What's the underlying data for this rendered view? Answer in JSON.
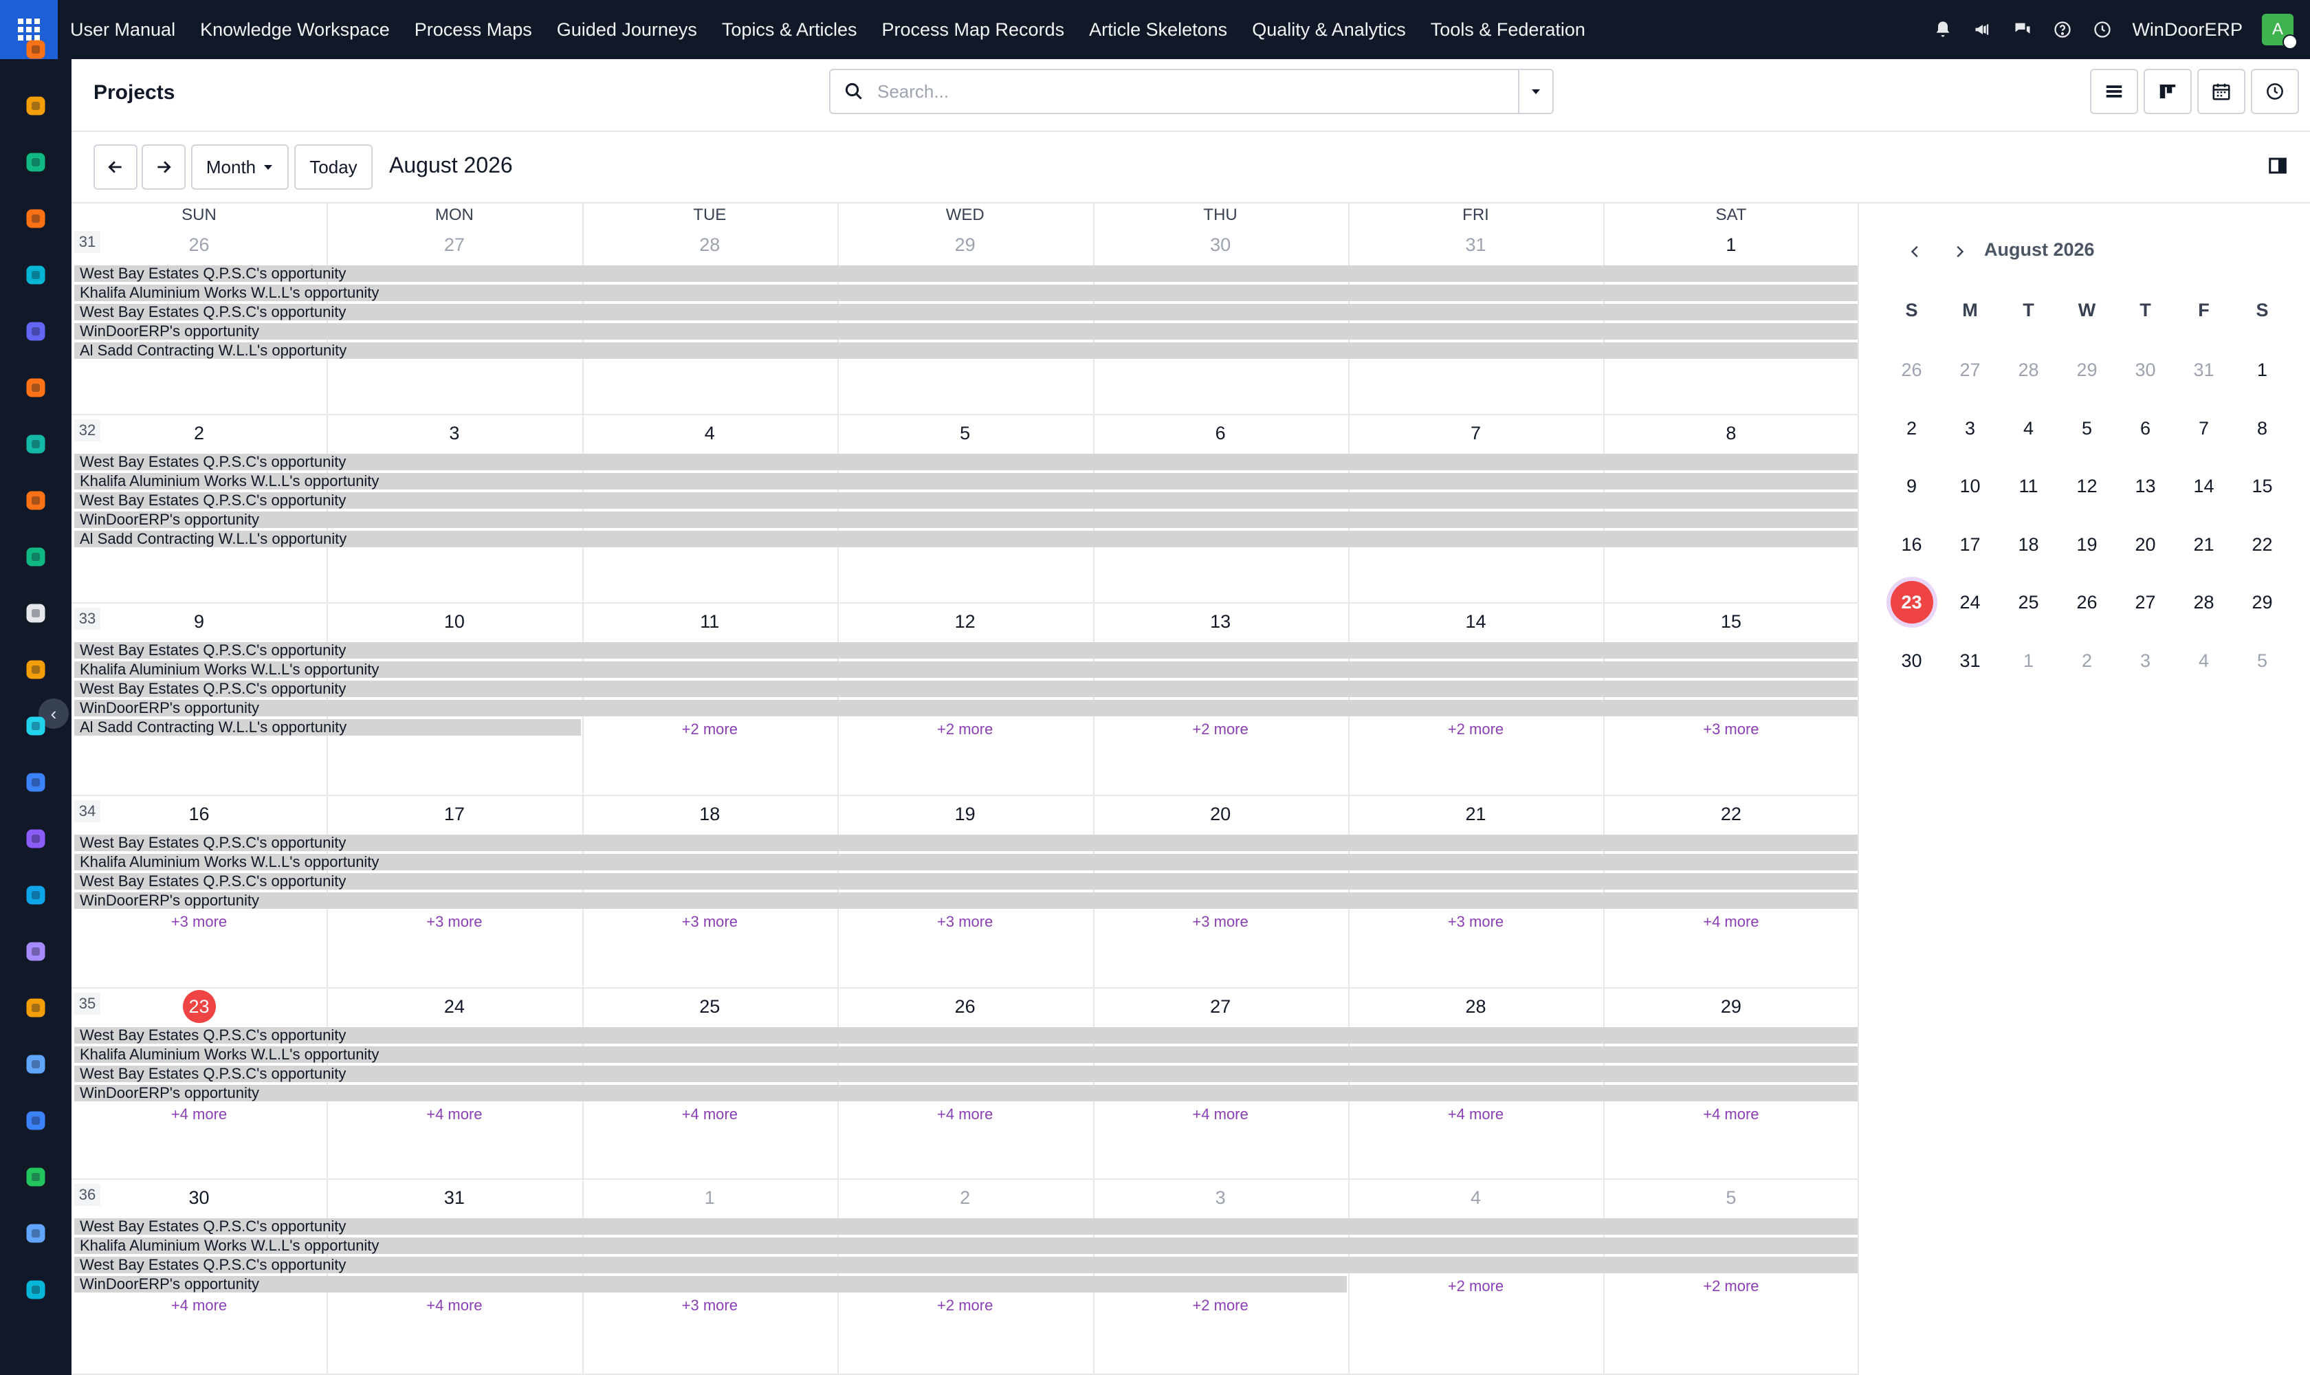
{
  "topbar": {
    "menu": [
      "User Manual",
      "Knowledge Workspace",
      "Process Maps",
      "Guided Journeys",
      "Topics & Articles",
      "Process Map Records",
      "Article Skeletons",
      "Quality & Analytics",
      "Tools & Federation"
    ],
    "company": "WinDoorERP",
    "avatar_letter": "A",
    "icons": [
      "bell-icon",
      "megaphone-icon",
      "chat-icon",
      "help-icon",
      "clock-icon"
    ]
  },
  "header": {
    "title": "Projects",
    "search_placeholder": "Search..."
  },
  "toolbar": {
    "prev_label": "←",
    "next_label": "→",
    "scale_label": "Month",
    "today_label": "Today",
    "period_label": "August 2026"
  },
  "calendar": {
    "weekdays": [
      "SUN",
      "MON",
      "TUE",
      "WED",
      "THU",
      "FRI",
      "SAT"
    ],
    "weeks": [
      {
        "number": "31",
        "days": [
          {
            "d": "26",
            "muted": true
          },
          {
            "d": "27",
            "muted": true
          },
          {
            "d": "28",
            "muted": true
          },
          {
            "d": "29",
            "muted": true
          },
          {
            "d": "30",
            "muted": true
          },
          {
            "d": "31",
            "muted": true
          },
          {
            "d": "1"
          }
        ],
        "events": [
          {
            "title": "West Bay Estates Q.P.S.C's opportunity",
            "start": 0,
            "span": 7
          },
          {
            "title": "Khalifa Aluminium Works W.L.L's opportunity",
            "start": 0,
            "span": 7
          },
          {
            "title": "West Bay Estates Q.P.S.C's opportunity",
            "start": 0,
            "span": 7
          },
          {
            "title": "WinDoorERP's opportunity",
            "start": 0,
            "span": 7
          },
          {
            "title": "Al Sadd Contracting W.L.L's opportunity",
            "start": 0,
            "span": 7
          }
        ],
        "more": []
      },
      {
        "number": "32",
        "days": [
          {
            "d": "2"
          },
          {
            "d": "3"
          },
          {
            "d": "4"
          },
          {
            "d": "5"
          },
          {
            "d": "6"
          },
          {
            "d": "7"
          },
          {
            "d": "8"
          }
        ],
        "events": [
          {
            "title": "West Bay Estates Q.P.S.C's opportunity",
            "start": 0,
            "span": 7
          },
          {
            "title": "Khalifa Aluminium Works W.L.L's opportunity",
            "start": 0,
            "span": 7
          },
          {
            "title": "West Bay Estates Q.P.S.C's opportunity",
            "start": 0,
            "span": 7
          },
          {
            "title": "WinDoorERP's opportunity",
            "start": 0,
            "span": 7
          },
          {
            "title": "Al Sadd Contracting W.L.L's opportunity",
            "start": 0,
            "span": 7
          }
        ],
        "more": []
      },
      {
        "number": "33",
        "days": [
          {
            "d": "9"
          },
          {
            "d": "10"
          },
          {
            "d": "11"
          },
          {
            "d": "12"
          },
          {
            "d": "13"
          },
          {
            "d": "14"
          },
          {
            "d": "15"
          }
        ],
        "events": [
          {
            "title": "West Bay Estates Q.P.S.C's opportunity",
            "start": 0,
            "span": 7
          },
          {
            "title": "Khalifa Aluminium Works W.L.L's opportunity",
            "start": 0,
            "span": 7
          },
          {
            "title": "West Bay Estates Q.P.S.C's opportunity",
            "start": 0,
            "span": 7
          },
          {
            "title": "WinDoorERP's opportunity",
            "start": 0,
            "span": 7
          },
          {
            "title": "Al Sadd Contracting W.L.L's opportunity",
            "start": 0,
            "span": 2
          }
        ],
        "more": [
          {
            "col": 2,
            "label": "+2 more",
            "row": 4
          },
          {
            "col": 3,
            "label": "+2 more",
            "row": 4
          },
          {
            "col": 4,
            "label": "+2 more",
            "row": 4
          },
          {
            "col": 5,
            "label": "+2 more",
            "row": 4
          },
          {
            "col": 6,
            "label": "+3 more",
            "row": 4
          }
        ]
      },
      {
        "number": "34",
        "days": [
          {
            "d": "16"
          },
          {
            "d": "17"
          },
          {
            "d": "18"
          },
          {
            "d": "19"
          },
          {
            "d": "20"
          },
          {
            "d": "21"
          },
          {
            "d": "22"
          }
        ],
        "events": [
          {
            "title": "West Bay Estates Q.P.S.C's opportunity",
            "start": 0,
            "span": 7
          },
          {
            "title": "Khalifa Aluminium Works W.L.L's opportunity",
            "start": 0,
            "span": 7
          },
          {
            "title": "West Bay Estates Q.P.S.C's opportunity",
            "start": 0,
            "span": 7
          },
          {
            "title": "WinDoorERP's opportunity",
            "start": 0,
            "span": 7
          }
        ],
        "more": [
          {
            "col": 0,
            "label": "+3 more",
            "row": 4
          },
          {
            "col": 1,
            "label": "+3 more",
            "row": 4
          },
          {
            "col": 2,
            "label": "+3 more",
            "row": 4
          },
          {
            "col": 3,
            "label": "+3 more",
            "row": 4
          },
          {
            "col": 4,
            "label": "+3 more",
            "row": 4
          },
          {
            "col": 5,
            "label": "+3 more",
            "row": 4
          },
          {
            "col": 6,
            "label": "+4 more",
            "row": 4
          }
        ]
      },
      {
        "number": "35",
        "days": [
          {
            "d": "23",
            "today": true
          },
          {
            "d": "24"
          },
          {
            "d": "25"
          },
          {
            "d": "26"
          },
          {
            "d": "27"
          },
          {
            "d": "28"
          },
          {
            "d": "29"
          }
        ],
        "events": [
          {
            "title": "West Bay Estates Q.P.S.C's opportunity",
            "start": 0,
            "span": 7
          },
          {
            "title": "Khalifa Aluminium Works W.L.L's opportunity",
            "start": 0,
            "span": 7
          },
          {
            "title": "West Bay Estates Q.P.S.C's opportunity",
            "start": 0,
            "span": 7
          },
          {
            "title": "WinDoorERP's opportunity",
            "start": 0,
            "span": 7
          }
        ],
        "more": [
          {
            "col": 0,
            "label": "+4 more",
            "row": 4
          },
          {
            "col": 1,
            "label": "+4 more",
            "row": 4
          },
          {
            "col": 2,
            "label": "+4 more",
            "row": 4
          },
          {
            "col": 3,
            "label": "+4 more",
            "row": 4
          },
          {
            "col": 4,
            "label": "+4 more",
            "row": 4
          },
          {
            "col": 5,
            "label": "+4 more",
            "row": 4
          },
          {
            "col": 6,
            "label": "+4 more",
            "row": 4
          }
        ]
      },
      {
        "number": "36",
        "days": [
          {
            "d": "30"
          },
          {
            "d": "31"
          },
          {
            "d": "1",
            "muted": true
          },
          {
            "d": "2",
            "muted": true
          },
          {
            "d": "3",
            "muted": true
          },
          {
            "d": "4",
            "muted": true
          },
          {
            "d": "5",
            "muted": true
          }
        ],
        "events": [
          {
            "title": "West Bay Estates Q.P.S.C's opportunity",
            "start": 0,
            "span": 7
          },
          {
            "title": "Khalifa Aluminium Works W.L.L's opportunity",
            "start": 0,
            "span": 7
          },
          {
            "title": "West Bay Estates Q.P.S.C's opportunity",
            "start": 0,
            "span": 7
          },
          {
            "title": "WinDoorERP's opportunity",
            "start": 0,
            "span": 5
          }
        ],
        "more": [
          {
            "col": 0,
            "label": "+4 more",
            "row": 4
          },
          {
            "col": 1,
            "label": "+4 more",
            "row": 4
          },
          {
            "col": 2,
            "label": "+3 more",
            "row": 4
          },
          {
            "col": 3,
            "label": "+2 more",
            "row": 4
          },
          {
            "col": 4,
            "label": "+2 more",
            "row": 4
          },
          {
            "col": 5,
            "label": "+2 more",
            "row": 3
          },
          {
            "col": 6,
            "label": "+2 more",
            "row": 3
          }
        ]
      }
    ]
  },
  "mini_calendar": {
    "title": "August 2026",
    "weekdays": [
      "S",
      "M",
      "T",
      "W",
      "T",
      "F",
      "S"
    ],
    "weeks": [
      [
        {
          "d": "26",
          "muted": true
        },
        {
          "d": "27",
          "muted": true
        },
        {
          "d": "28",
          "muted": true
        },
        {
          "d": "29",
          "muted": true
        },
        {
          "d": "30",
          "muted": true
        },
        {
          "d": "31",
          "muted": true
        },
        {
          "d": "1"
        }
      ],
      [
        {
          "d": "2"
        },
        {
          "d": "3"
        },
        {
          "d": "4"
        },
        {
          "d": "5"
        },
        {
          "d": "6"
        },
        {
          "d": "7"
        },
        {
          "d": "8"
        }
      ],
      [
        {
          "d": "9"
        },
        {
          "d": "10"
        },
        {
          "d": "11"
        },
        {
          "d": "12"
        },
        {
          "d": "13"
        },
        {
          "d": "14"
        },
        {
          "d": "15"
        }
      ],
      [
        {
          "d": "16"
        },
        {
          "d": "17"
        },
        {
          "d": "18"
        },
        {
          "d": "19"
        },
        {
          "d": "20"
        },
        {
          "d": "21"
        },
        {
          "d": "22"
        }
      ],
      [
        {
          "d": "23",
          "today": true
        },
        {
          "d": "24"
        },
        {
          "d": "25"
        },
        {
          "d": "26"
        },
        {
          "d": "27"
        },
        {
          "d": "28"
        },
        {
          "d": "29"
        }
      ],
      [
        {
          "d": "30"
        },
        {
          "d": "31"
        },
        {
          "d": "1",
          "muted": true
        },
        {
          "d": "2",
          "muted": true
        },
        {
          "d": "3",
          "muted": true
        },
        {
          "d": "4",
          "muted": true
        },
        {
          "d": "5",
          "muted": true
        }
      ]
    ]
  },
  "colors": {
    "topbar": "#111827",
    "apps_button": "#1d5fd6",
    "today": "#ef4444",
    "event_bar": "#d4d4d4",
    "more_link": "#8b3fb5"
  },
  "rail_icons": [
    "sales-app-icon",
    "photos-app-icon",
    "contacts-app-icon",
    "discuss-app-icon",
    "website-app-icon",
    "mail-app-icon",
    "livechat-app-icon",
    "marketing-app-icon",
    "reporting-app-icon",
    "employees-app-icon",
    "inventory-app-icon",
    "studio-app-icon",
    "project-app-icon",
    "knowledge-app-icon",
    "manufacturing-app-icon",
    "invoicing-app-icon",
    "team-app-icon",
    "calendar-app-icon",
    "sign-app-icon",
    "dashboard-app-icon",
    "whatsapp-app-icon",
    "timer-app-icon",
    "helpdesk-app-icon"
  ]
}
